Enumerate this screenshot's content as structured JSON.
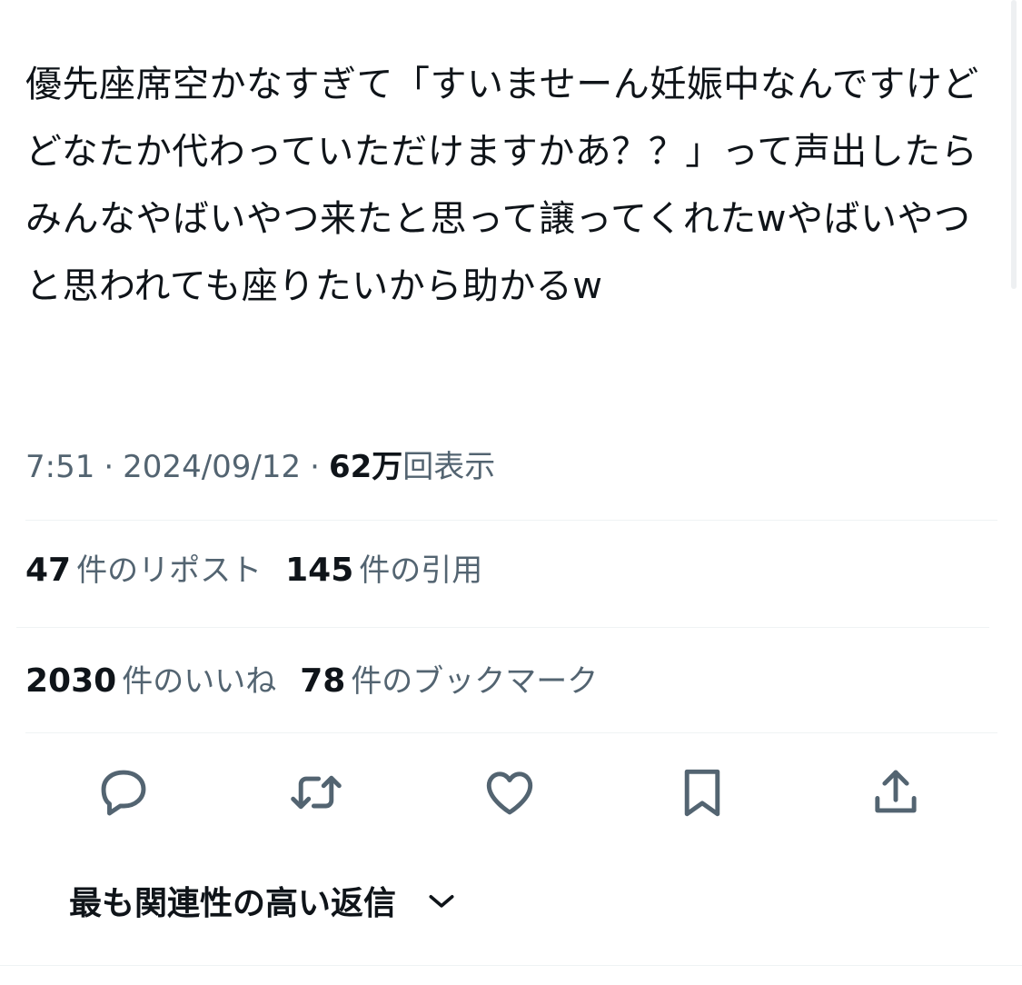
{
  "tweet": {
    "text": "優先座席空かなすぎて「すいませーん妊娠中なんですけどどなたか代わっていただけますかあ？？」って声出したらみんなやばいやつ来たと思って譲ってくれたwやばいやつと思われても座りたいから助かるw"
  },
  "meta": {
    "time": "7:51",
    "separator": "·",
    "date": "2024/09/12",
    "views_count": "62万",
    "views_label": "回表示"
  },
  "stats": {
    "reposts": {
      "count": "47",
      "label": "件のリポスト"
    },
    "quotes": {
      "count": "145",
      "label": "件の引用"
    },
    "likes": {
      "count": "2030",
      "label": "件のいいね"
    },
    "bookmarks": {
      "count": "78",
      "label": "件のブックマーク"
    }
  },
  "actions": [
    {
      "name": "reply",
      "icon": "speech-bubble-icon"
    },
    {
      "name": "repost",
      "icon": "repost-arrows-icon"
    },
    {
      "name": "like",
      "icon": "heart-icon"
    },
    {
      "name": "bookmark",
      "icon": "bookmark-icon"
    },
    {
      "name": "share",
      "icon": "share-upload-icon"
    }
  ],
  "replies": {
    "sort_label": "最も関連性の高い返信"
  },
  "colors": {
    "text_primary": "#0f1419",
    "text_secondary": "#536471",
    "divider": "#eff3f4",
    "background": "#ffffff"
  }
}
